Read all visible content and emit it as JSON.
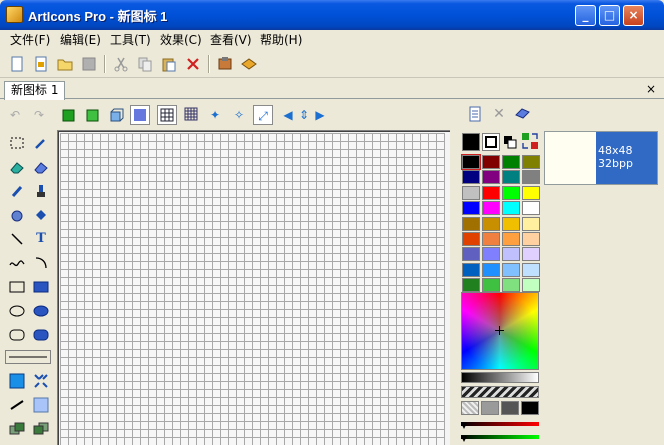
{
  "window": {
    "title": "ArtIcons Pro - 新图标 1"
  },
  "menu": [
    "文件(F)",
    "编辑(E)",
    "工具(T)",
    "效果(C)",
    "查看(V)",
    "帮助(H)"
  ],
  "tabs": {
    "document": "新图标 1",
    "close_glyph": "×"
  },
  "caption_buttons": {
    "minimize": "_",
    "maximize": "□",
    "close": "×"
  },
  "tools": {
    "text_glyph": "T"
  },
  "preview": {
    "size": "48x48",
    "depth": "32bpp"
  },
  "colors": {
    "titlebar": "#0051d8",
    "selection": "#316ac5",
    "palette": [
      [
        "#000000",
        "#800000",
        "#008000",
        "#808000"
      ],
      [
        "#000080",
        "#800080",
        "#008080",
        "#808080"
      ],
      [
        "#c0c0c0",
        "#ff0000",
        "#00ff00",
        "#ffff00"
      ],
      [
        "#0000ff",
        "#ff00ff",
        "#00ffff",
        "#ffffff"
      ],
      [
        "#a07000",
        "#c89000",
        "#f0c000",
        "#fff0a0"
      ],
      [
        "#e04000",
        "#f08040",
        "#ffa040",
        "#ffd0a0"
      ],
      [
        "#6060c0",
        "#8080ff",
        "#c0c0ff",
        "#e0d0ff"
      ],
      [
        "#0060c0",
        "#2090ff",
        "#80c0ff",
        "#c0e0ff"
      ],
      [
        "#208020",
        "#40c040",
        "#80e080",
        "#c0ffc0"
      ]
    ]
  }
}
